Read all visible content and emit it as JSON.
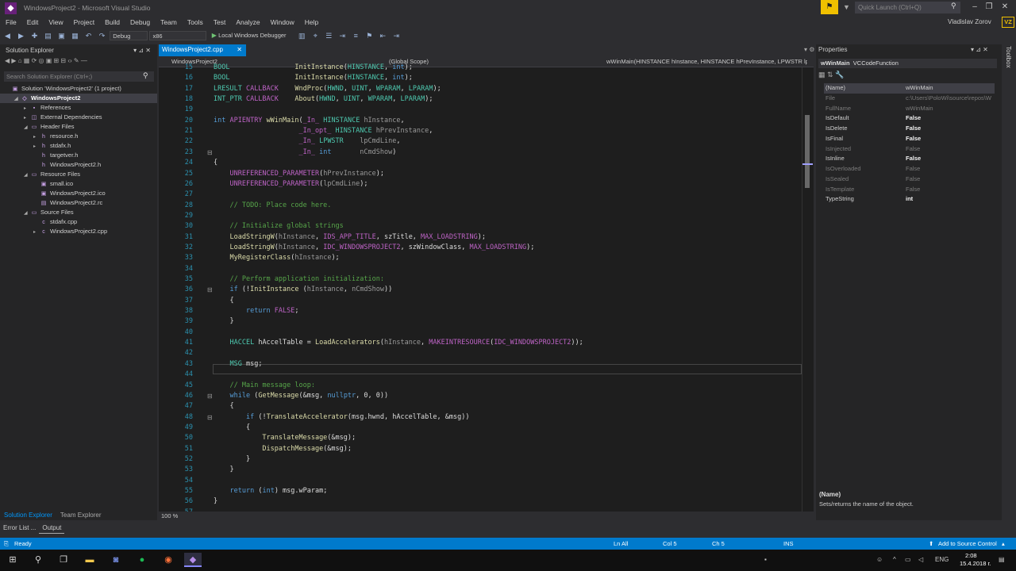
{
  "window": {
    "title": "WindowsProject2 - Microsoft Visual Studio",
    "quick_launch_placeholder": "Quick Launch (Ctrl+Q)",
    "user": "Vladislav Zorov",
    "avatar_initials": "VZ"
  },
  "menu": [
    "File",
    "Edit",
    "View",
    "Project",
    "Build",
    "Debug",
    "Team",
    "Tools",
    "Test",
    "Analyze",
    "Window",
    "Help"
  ],
  "toolbar": {
    "config": "Debug",
    "platform": "x86",
    "run_label": "Local Windows Debugger"
  },
  "solution_explorer": {
    "title": "Solution Explorer",
    "search_placeholder": "Search Solution Explorer (Ctrl+;)",
    "tree": [
      {
        "label": "Solution 'WindowsProject2' (1 project)",
        "indent": 0,
        "exp": "",
        "icon": "solution-icon"
      },
      {
        "label": "WindowsProject2",
        "indent": 1,
        "exp": "◢",
        "icon": "project-icon",
        "selected": true,
        "bold": true
      },
      {
        "label": "References",
        "indent": 2,
        "exp": "▸",
        "icon": "references-icon"
      },
      {
        "label": "External Dependencies",
        "indent": 2,
        "exp": "▸",
        "icon": "external-dependencies-icon"
      },
      {
        "label": "Header Files",
        "indent": 2,
        "exp": "◢",
        "icon": "folder-icon"
      },
      {
        "label": "resource.h",
        "indent": 3,
        "exp": "▸",
        "icon": "header-file-icon"
      },
      {
        "label": "stdafx.h",
        "indent": 3,
        "exp": "▸",
        "icon": "header-file-icon"
      },
      {
        "label": "targetver.h",
        "indent": 3,
        "exp": "",
        "icon": "header-file-icon"
      },
      {
        "label": "WindowsProject2.h",
        "indent": 3,
        "exp": "",
        "icon": "header-file-icon"
      },
      {
        "label": "Resource Files",
        "indent": 2,
        "exp": "◢",
        "icon": "folder-icon"
      },
      {
        "label": "small.ico",
        "indent": 3,
        "exp": "",
        "icon": "icon-file-icon"
      },
      {
        "label": "WindowsProject2.ico",
        "indent": 3,
        "exp": "",
        "icon": "icon-file-icon"
      },
      {
        "label": "WindowsProject2.rc",
        "indent": 3,
        "exp": "",
        "icon": "resource-file-icon"
      },
      {
        "label": "Source Files",
        "indent": 2,
        "exp": "◢",
        "icon": "folder-icon"
      },
      {
        "label": "stdafx.cpp",
        "indent": 3,
        "exp": "",
        "icon": "cpp-file-icon"
      },
      {
        "label": "WindowsProject2.cpp",
        "indent": 3,
        "exp": "▸",
        "icon": "cpp-file-icon"
      }
    ],
    "tabs": [
      "Solution Explorer",
      "Team Explorer"
    ]
  },
  "bottom_tabs": [
    "Error List ...",
    "Output"
  ],
  "editor": {
    "tab": "WindowsProject2.cpp",
    "nav_project": "WindowsProject2",
    "nav_scope": "(Global Scope)",
    "nav_function": "wWinMain(HINSTANCE hInstance, HINSTANCE hPrevInstance, LPWSTR lpCmdLine, int nCmdShow)",
    "zoom": "100 %",
    "lines": [
      {
        "n": "15",
        "h": "<span class=\"ty\">BOOL</span>                <span class=\"fn\">InitInstance</span>(<span class=\"ty\">HINSTANCE</span>, <span class=\"kw\">int</span>);"
      },
      {
        "n": "16",
        "h": "<span class=\"ty\">BOOL</span>                <span class=\"fn\">InitInstance</span>(<span class=\"ty\">HINSTANCE</span>, <span class=\"kw\">int</span>);"
      },
      {
        "n": "17",
        "h": "<span class=\"ty\">LRESULT</span> <span class=\"mc\">CALLBACK</span>    <span class=\"fn\">WndProc</span>(<span class=\"ty\">HWND</span>, <span class=\"ty\">UINT</span>, <span class=\"ty\">WPARAM</span>, <span class=\"ty\">LPARAM</span>);"
      },
      {
        "n": "18",
        "h": "<span class=\"ty\">INT_PTR</span> <span class=\"mc\">CALLBACK</span>    <span class=\"fn\">About</span>(<span class=\"ty\">HWND</span>, <span class=\"ty\">UINT</span>, <span class=\"ty\">WPARAM</span>, <span class=\"ty\">LPARAM</span>);"
      },
      {
        "n": "19",
        "h": ""
      },
      {
        "n": "20",
        "h": "<span class=\"kw\">int</span> <span class=\"mc\">APIENTRY</span> <span class=\"fn\">wWinMain</span>(<span class=\"mc\">_In_</span> <span class=\"ty\">HINSTANCE</span> <span class=\"pa\">hInstance</span>,"
      },
      {
        "n": "21",
        "h": "                     <span class=\"mc\">_In_opt_</span> <span class=\"ty\">HINSTANCE</span> <span class=\"pa\">hPrevInstance</span>,"
      },
      {
        "n": "22",
        "h": "                     <span class=\"mc\">_In_</span> <span class=\"ty\">LPWSTR</span>    <span class=\"pa\">lpCmdLine</span>,"
      },
      {
        "n": "23",
        "h": "                     <span class=\"mc\">_In_</span> <span class=\"kw\">int</span>       <span class=\"pa\">nCmdShow</span>)",
        "f": "⊟"
      },
      {
        "n": "24",
        "h": "{"
      },
      {
        "n": "25",
        "h": "    <span class=\"mc\">UNREFERENCED_PARAMETER</span>(<span class=\"pa\">hPrevInstance</span>);"
      },
      {
        "n": "26",
        "h": "    <span class=\"mc\">UNREFERENCED_PARAMETER</span>(<span class=\"pa\">lpCmdLine</span>);"
      },
      {
        "n": "27",
        "h": ""
      },
      {
        "n": "28",
        "h": "    <span class=\"cm\">// TODO: Place code here.</span>"
      },
      {
        "n": "29",
        "h": ""
      },
      {
        "n": "30",
        "h": "    <span class=\"cm\">// Initialize global strings</span>"
      },
      {
        "n": "31",
        "h": "    <span class=\"fn\">LoadStringW</span>(<span class=\"pa\">hInstance</span>, <span class=\"mc\">IDS_APP_TITLE</span>, szTitle, <span class=\"mc\">MAX_LOADSTRING</span>);"
      },
      {
        "n": "32",
        "h": "    <span class=\"fn\">LoadStringW</span>(<span class=\"pa\">hInstance</span>, <span class=\"mc\">IDC_WINDOWSPROJECT2</span>, szWindowClass, <span class=\"mc\">MAX_LOADSTRING</span>);"
      },
      {
        "n": "33",
        "h": "    <span class=\"fn\">MyRegisterClass</span>(<span class=\"pa\">hInstance</span>);"
      },
      {
        "n": "34",
        "h": ""
      },
      {
        "n": "35",
        "h": "    <span class=\"cm\">// Perform application initialization:</span>"
      },
      {
        "n": "36",
        "h": "    <span class=\"kw\">if</span> (!<span class=\"fn\">InitInstance</span> (<span class=\"pa\">hInstance</span>, <span class=\"pa\">nCmdShow</span>))",
        "f": "⊟"
      },
      {
        "n": "37",
        "h": "    {"
      },
      {
        "n": "38",
        "h": "        <span class=\"kw\">return</span> <span class=\"mc\">FALSE</span>;"
      },
      {
        "n": "39",
        "h": "    }"
      },
      {
        "n": "40",
        "h": ""
      },
      {
        "n": "41",
        "h": "    <span class=\"ty\">HACCEL</span> hAccelTable = <span class=\"fn\">LoadAccelerators</span>(<span class=\"pa\">hInstance</span>, <span class=\"mc\">MAKEINTRESOURCE</span>(<span class=\"mc\">IDC_WINDOWSPROJECT2</span>));"
      },
      {
        "n": "42",
        "h": ""
      },
      {
        "n": "43",
        "h": "    <span class=\"ty\">MSG</span> msg;"
      },
      {
        "n": "44",
        "h": ""
      },
      {
        "n": "45",
        "h": "    <span class=\"cm\">// Main message loop:</span>"
      },
      {
        "n": "46",
        "h": "    <span class=\"kw\">while</span> (<span class=\"fn\">GetMessage</span>(&amp;msg, <span class=\"kw\">nullptr</span>, 0, 0))",
        "f": "⊟"
      },
      {
        "n": "47",
        "h": "    {"
      },
      {
        "n": "48",
        "h": "        <span class=\"kw\">if</span> (!<span class=\"fn\">TranslateAccelerator</span>(msg.hwnd, hAccelTable, &amp;msg))",
        "f": "⊟"
      },
      {
        "n": "49",
        "h": "        {"
      },
      {
        "n": "50",
        "h": "            <span class=\"fn\">TranslateMessage</span>(&amp;msg);"
      },
      {
        "n": "51",
        "h": "            <span class=\"fn\">DispatchMessage</span>(&amp;msg);"
      },
      {
        "n": "52",
        "h": "        }"
      },
      {
        "n": "53",
        "h": "    }"
      },
      {
        "n": "54",
        "h": ""
      },
      {
        "n": "55",
        "h": "    <span class=\"kw\">return</span> (<span class=\"kw\">int</span>) msg.wParam;"
      },
      {
        "n": "56",
        "h": "}"
      },
      {
        "n": "57",
        "h": ""
      }
    ]
  },
  "properties": {
    "title": "Properties",
    "object_name": "wWinMain",
    "object_type": "VCCodeFunction",
    "rows": [
      {
        "name": "(Name)",
        "value": "wWinMain",
        "state": "sel"
      },
      {
        "name": "File",
        "value": "c:\\Users\\PoloWi\\source\\repos\\Wi",
        "state": "dim"
      },
      {
        "name": "FullName",
        "value": "wWinMain",
        "state": "dim"
      },
      {
        "name": "IsDefault",
        "value": "False",
        "state": "bold"
      },
      {
        "name": "IsDelete",
        "value": "False",
        "state": "bold"
      },
      {
        "name": "IsFinal",
        "value": "False",
        "state": "bold"
      },
      {
        "name": "IsInjected",
        "value": "False",
        "state": "dim"
      },
      {
        "name": "IsInline",
        "value": "False",
        "state": "bold"
      },
      {
        "name": "IsOverloaded",
        "value": "False",
        "state": "dim"
      },
      {
        "name": "IsSealed",
        "value": "False",
        "state": "dim"
      },
      {
        "name": "IsTemplate",
        "value": "False",
        "state": "dim"
      },
      {
        "name": "TypeString",
        "value": "int",
        "state": "bold"
      }
    ],
    "desc_name": "(Name)",
    "desc_text": "Sets/returns the name of the object."
  },
  "toolbox_label": "Toolbox",
  "status": {
    "ready": "Ready",
    "ln": "Ln All",
    "col": "Col 5",
    "ch": "Ch 5",
    "ins": "INS",
    "source_control": "Add to Source Control"
  },
  "taskbar": {
    "lang": "ENG",
    "time": "2:08",
    "date": "15.4.2018 г."
  },
  "colors": {
    "accent": "#007acc",
    "editor_bg": "#1e1e1e",
    "panel_bg": "#252526",
    "notif": "#f0c000"
  }
}
